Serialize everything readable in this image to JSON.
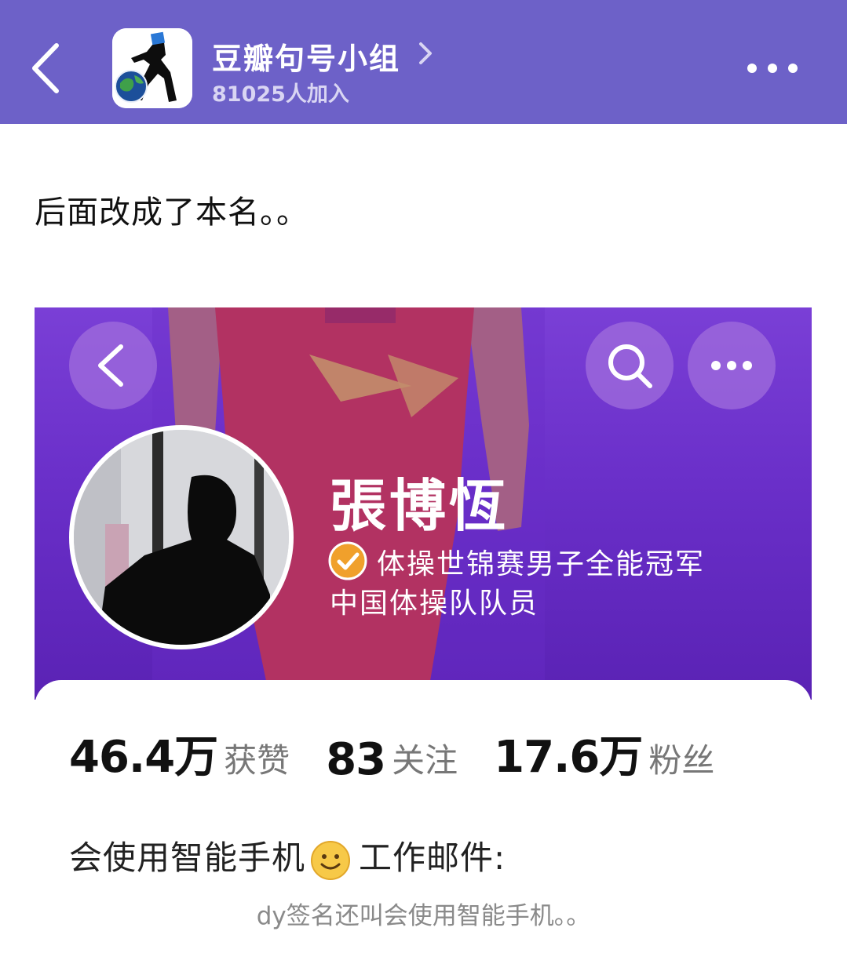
{
  "header": {
    "group_name": "豆瓣句号小组",
    "member_count": "81025人加入",
    "back_icon": "chevron-left-icon",
    "more_icon": "more-dots-icon",
    "chevron_icon": "chevron-right-icon",
    "bar_color": "#6d61c8"
  },
  "post": {
    "text": "后面改成了本名。。"
  },
  "screenshot": {
    "name": "張博恆",
    "verified_text": "体操世锦赛男子全能冠军",
    "team_text": "中国体操队队员",
    "verified_color": "#f0a02c",
    "stats": [
      {
        "value": "46.4万",
        "label": "获赞"
      },
      {
        "value": "83",
        "label": "关注"
      },
      {
        "value": "17.6万",
        "label": "粉丝"
      }
    ],
    "bio_left": "会使用智能手机",
    "bio_right": "工作邮件:"
  },
  "caption": "dy签名还叫会使用智能手机。。"
}
